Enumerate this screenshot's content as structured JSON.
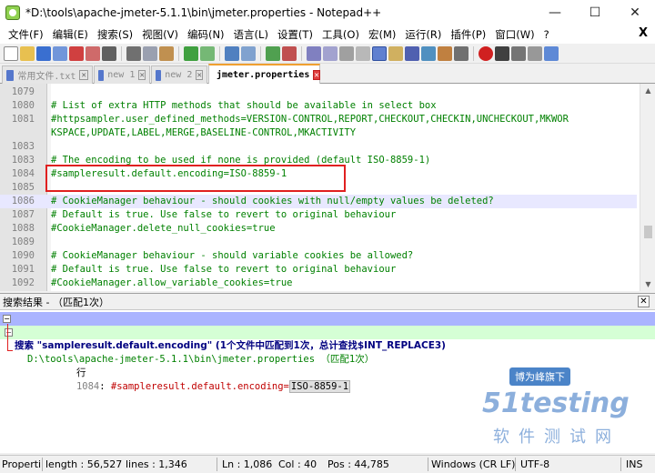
{
  "window": {
    "title": "*D:\\tools\\apache-jmeter-5.1.1\\bin\\jmeter.properties - Notepad++",
    "minimize": "—",
    "maximize": "☐",
    "close": "✕"
  },
  "menu": {
    "items": [
      "文件(F)",
      "编辑(E)",
      "搜索(S)",
      "视图(V)",
      "编码(N)",
      "语言(L)",
      "设置(T)",
      "工具(O)",
      "宏(M)",
      "运行(R)",
      "插件(P)",
      "窗口(W)",
      "?"
    ],
    "close": "X"
  },
  "tabs": [
    {
      "label": "常用文件.txt",
      "close": "✕"
    },
    {
      "label": "new 1",
      "close": "✕"
    },
    {
      "label": "new 2",
      "close": "✕"
    },
    {
      "label": "jmeter.properties",
      "close": "✕"
    }
  ],
  "editor": {
    "lines": [
      {
        "n": "1079",
        "text": ""
      },
      {
        "n": "1080",
        "text": "# List of extra HTTP methods that should be available in select box"
      },
      {
        "n": "1081",
        "text": "#httpsampler.user_defined_methods=VERSION-CONTROL,REPORT,CHECKOUT,CHECKIN,UNCHECKOUT,MKWOR"
      },
      {
        "n": "",
        "text": "KSPACE,UPDATE,LABEL,MERGE,BASELINE-CONTROL,MKACTIVITY"
      },
      {
        "n": "1083",
        "text": ""
      },
      {
        "n": "1083",
        "text": "# The encoding to be used if none is provided (default ISO-8859-1)"
      },
      {
        "n": "1084",
        "text": "#sampleresult.default.encoding=ISO-8859-1"
      },
      {
        "n": "1085",
        "text": ""
      },
      {
        "n": "1086",
        "text": "# CookieManager behaviour - should cookies with null/empty values be deleted?"
      },
      {
        "n": "1087",
        "text": "# Default is true. Use false to revert to original behaviour"
      },
      {
        "n": "1088",
        "text": "#CookieManager.delete_null_cookies=true"
      },
      {
        "n": "1089",
        "text": ""
      },
      {
        "n": "1090",
        "text": "# CookieManager behaviour - should variable cookies be allowed?"
      },
      {
        "n": "1091",
        "text": "# Default is true. Use false to revert to original behaviour"
      },
      {
        "n": "1092",
        "text": "#CookieManager.allow_variable_cookies=true"
      }
    ]
  },
  "search": {
    "panel_title": "搜索结果 - （匹配1次）",
    "close": "✕",
    "header": "搜索 \"sampleresult.default.encoding\" (1个文件中匹配到1次，总计查找$INT_REPLACE3)",
    "file_line": "D:\\tools\\apache-jmeter-5.1.1\\bin\\jmeter.properties （匹配1次）",
    "hit_prefix": "行",
    "hit_line": "1084",
    "hit_text": "#sampleresult.default.encoding=",
    "hit_match": "ISO-8859-1"
  },
  "watermark": {
    "badge": "博为峰旗下",
    "logo": "51testing",
    "sub": "软件测试网"
  },
  "status": {
    "file_type": "Properti",
    "length": "length : 56,527",
    "lines": "lines : 1,346",
    "ln": "Ln : 1,086",
    "col": "Col : 40",
    "pos": "Pos : 44,785",
    "eol": "Windows (CR LF)",
    "encoding": "UTF-8",
    "mode": "INS"
  }
}
